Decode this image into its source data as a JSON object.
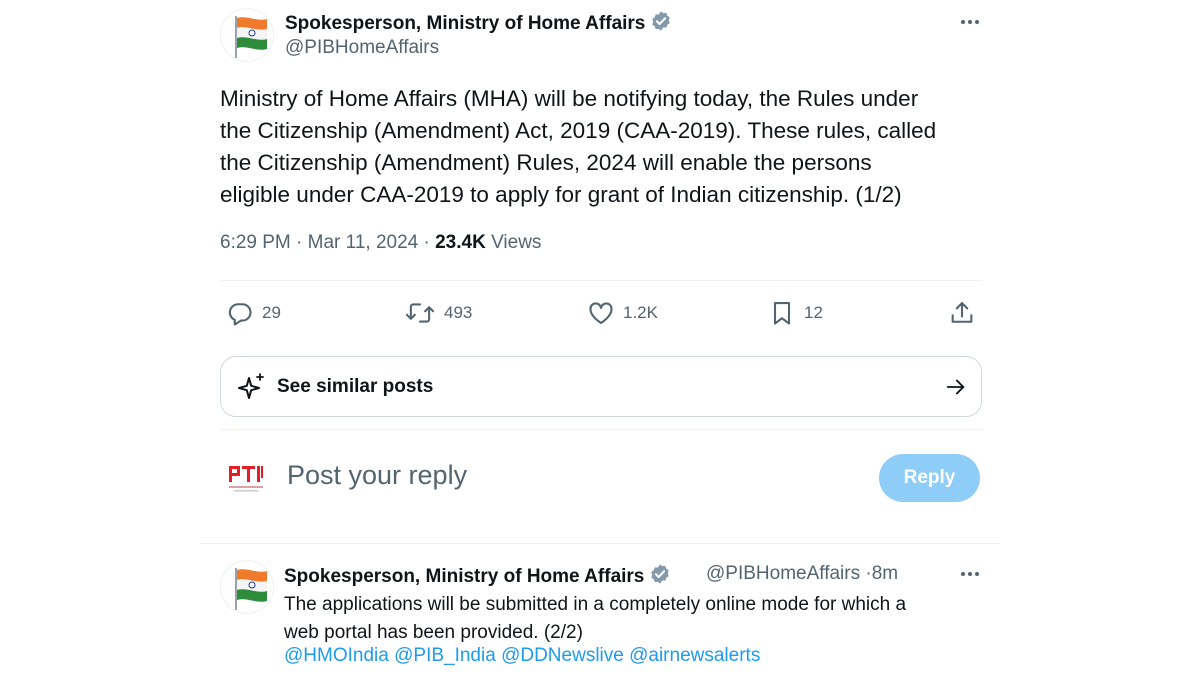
{
  "main_tweet": {
    "author_name": "Spokesperson, Ministry of Home Affairs",
    "handle": "@PIBHomeAffairs",
    "text_lines": [
      "Ministry of Home Affairs (MHA) will be notifying today, the Rules under",
      "the Citizenship (Amendment) Act, 2019 (CAA-2019). These rules, called",
      "the Citizenship (Amendment) Rules, 2024 will enable the persons",
      "eligible under CAA-2019 to apply for grant of Indian citizenship. (1/2)"
    ],
    "time": "6:29 PM",
    "separator": "·",
    "date": "Mar 11, 2024",
    "views_count": "23.4K",
    "views_label": "Views"
  },
  "actions": {
    "replies": "29",
    "reposts": "493",
    "likes": "1.2K",
    "bookmarks": "12"
  },
  "similar": {
    "label": "See similar posts"
  },
  "composer": {
    "placeholder": "Post your reply",
    "button_label": "Reply"
  },
  "reply_tweet": {
    "author_name": "Spokesperson, Ministry of Home Affairs",
    "handle": "@PIBHomeAffairs",
    "separator": "·",
    "time_ago": "8m",
    "text_lines": [
      "The applications will be submitted in a completely online mode for which a",
      "web portal has been provided. (2/2)"
    ],
    "mentions": [
      "@HMOIndia",
      "@PIB_India",
      "@DDNewslive",
      "@airnewsalerts"
    ]
  },
  "icons": {
    "verified": "verified-badge-icon",
    "more": "more-icon",
    "reply": "reply-icon",
    "repost": "repost-icon",
    "like": "heart-icon",
    "bookmark": "bookmark-icon",
    "share": "share-icon",
    "sparkle": "sparkle-icon",
    "arrow": "arrow-right-icon"
  },
  "colors": {
    "accent": "#1d9bf0",
    "reply_button": "#8ecdf8",
    "secondary_text": "#536471",
    "verified_badge": "#829aab"
  }
}
